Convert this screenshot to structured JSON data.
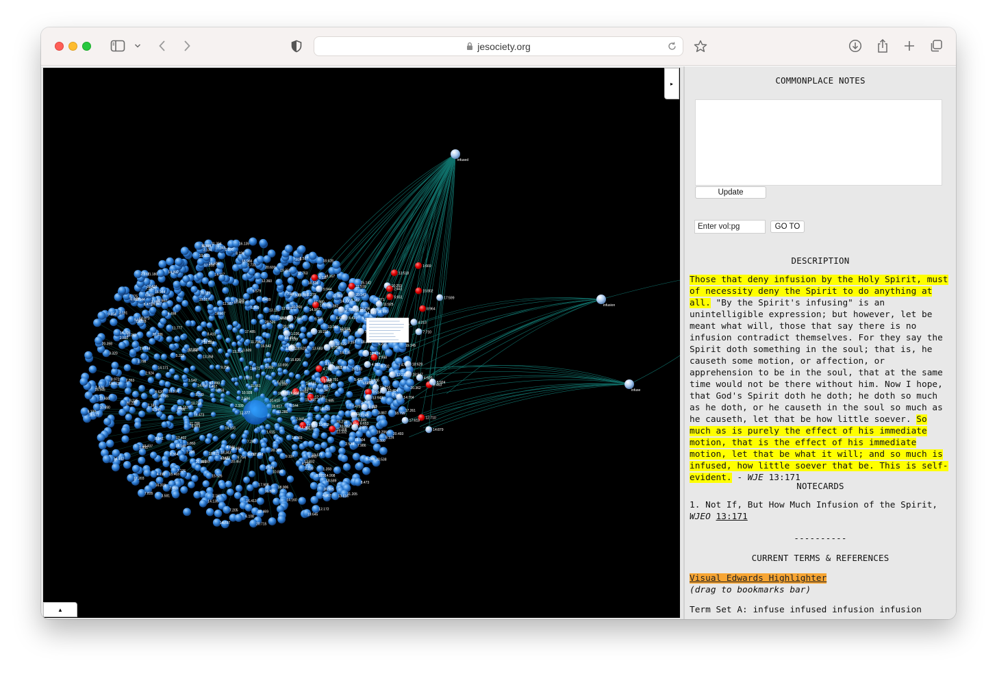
{
  "browser": {
    "url": "jesociety.org"
  },
  "graph": {
    "toggle_right": "▸",
    "toggle_bottom": "▲",
    "hub_labels": [
      "infused",
      "infusion",
      "infuse"
    ]
  },
  "panel": {
    "notes_title": "COMMONPLACE NOTES",
    "update_label": "Update",
    "vol_placeholder": "Enter vol:pg",
    "goto_label": "GO TO",
    "description_title": "DESCRIPTION",
    "desc_hl1": "Those that deny infusion by the Holy Spirit, must of necessity deny the Spirit to do anything at all.",
    "desc_plain": " \"By the Spirit's infusing\" is an unintelligible expression; but however, let be meant what will, those that say there is no infusion contradict themselves. For they say the Spirit doth something in the soul; that is, he causeth some motion, or affection, or apprehension to be in the soul, that at the same time would not be there without him. Now I hope, that God's Spirit doth he doth; he doth so much as he doth, or he causeth in the soul so much as he causeth, let that be how little soever. ",
    "desc_hl2": "So much as is purely the effect of his immediate motion, that is the effect of his immediate motion, let that be what it will; and so much is infused, how little soever that be. This is self-evident.",
    "desc_dash": " - ",
    "desc_source": "WJE",
    "desc_ref": " 13:171",
    "notecards_title": "NOTECARDS",
    "notecard_text": "1. Not If, But How Much Infusion of the Spirit,",
    "notecard_source": "WJEO",
    "notecard_ref": "13:171",
    "separator": "----------",
    "terms_title": "CURRENT TERMS & REFERENCES",
    "veh_link": "Visual Edwards Highlighter ",
    "veh_hint": "(drag to bookmarks bar)",
    "term_set": "Term Set A: infuse infused infusion infusion"
  }
}
